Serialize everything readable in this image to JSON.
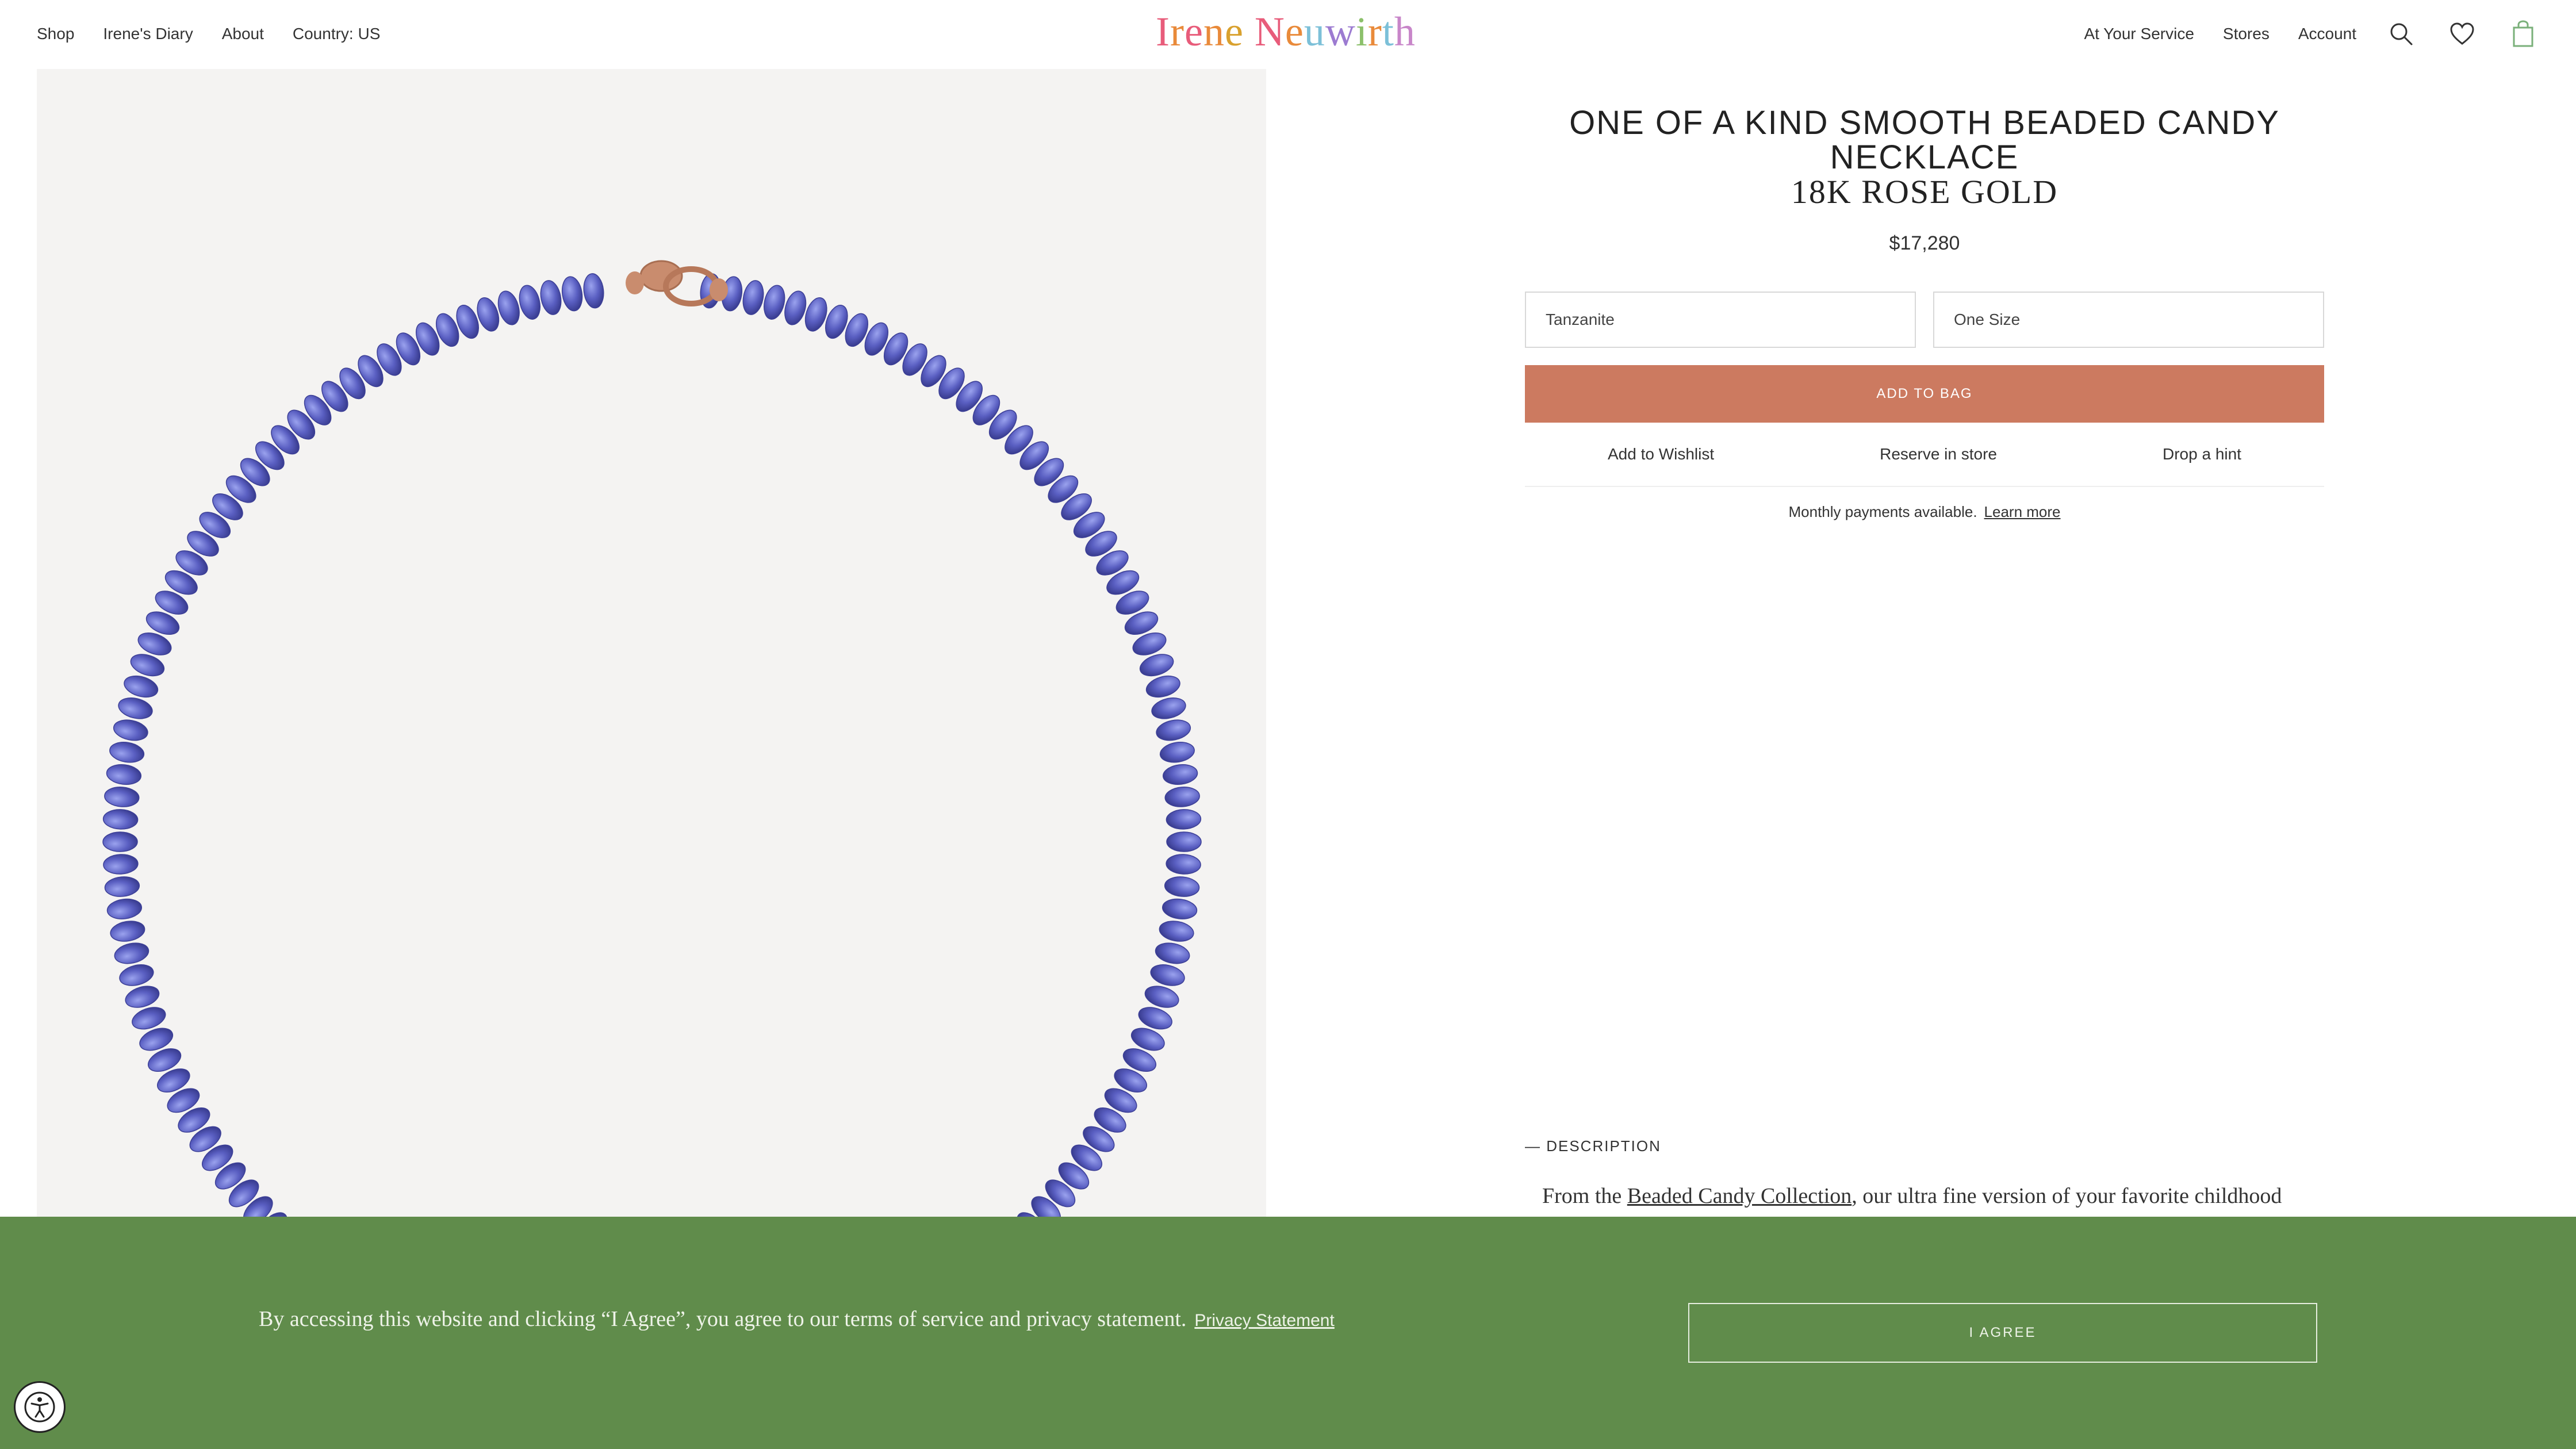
{
  "nav": {
    "left": [
      "Shop",
      "Irene's Diary",
      "About",
      "Country: US"
    ],
    "right": [
      "At Your Service",
      "Stores",
      "Account"
    ],
    "icons": [
      "search-icon",
      "heart-icon",
      "bag-icon"
    ]
  },
  "logo": {
    "letters": [
      {
        "ch": "I",
        "color": "#e85c7a"
      },
      {
        "ch": "r",
        "color": "#e98a3a"
      },
      {
        "ch": "e",
        "color": "#e85c7a"
      },
      {
        "ch": "n",
        "color": "#e98a3a"
      },
      {
        "ch": "e",
        "color": "#d9a12e"
      },
      {
        "ch": " ",
        "color": "#000000"
      },
      {
        "ch": "N",
        "color": "#e85c7a"
      },
      {
        "ch": "e",
        "color": "#e98a3a"
      },
      {
        "ch": "u",
        "color": "#7cc0d8"
      },
      {
        "ch": "w",
        "color": "#9c7bd1"
      },
      {
        "ch": "i",
        "color": "#8cc06b"
      },
      {
        "ch": "r",
        "color": "#e98a3a"
      },
      {
        "ch": "t",
        "color": "#7cc0d8"
      },
      {
        "ch": "h",
        "color": "#c886c9"
      }
    ]
  },
  "product": {
    "title": "ONE OF A KIND SMOOTH BEADED CANDY NECKLACE",
    "subtitle": "18K ROSE GOLD",
    "price": "$17,280",
    "stone_select": "Tanzanite",
    "size_select": "One Size",
    "add_to_bag": "ADD TO BAG",
    "actions": [
      "Add to Wishlist",
      "Reserve in store",
      "Drop a hint"
    ],
    "monthly_text": "Monthly payments available.",
    "learn_more": "Learn more"
  },
  "description": {
    "label": "— DESCRIPTION",
    "prefix": "From the ",
    "link": "Beaded Candy Collection",
    "suffix": ", our ultra fine version of your favorite childhood"
  },
  "cookie_banner": {
    "text": "By accessing this website and clicking “I Agree”, you agree to our terms of service and privacy statement.",
    "link": "Privacy Statement",
    "button": "I AGREE"
  },
  "colors": {
    "accent": "#cc7a60",
    "banner": "#608c4b",
    "bead": "#5a5fc2",
    "clasp": "#c98c6e"
  }
}
